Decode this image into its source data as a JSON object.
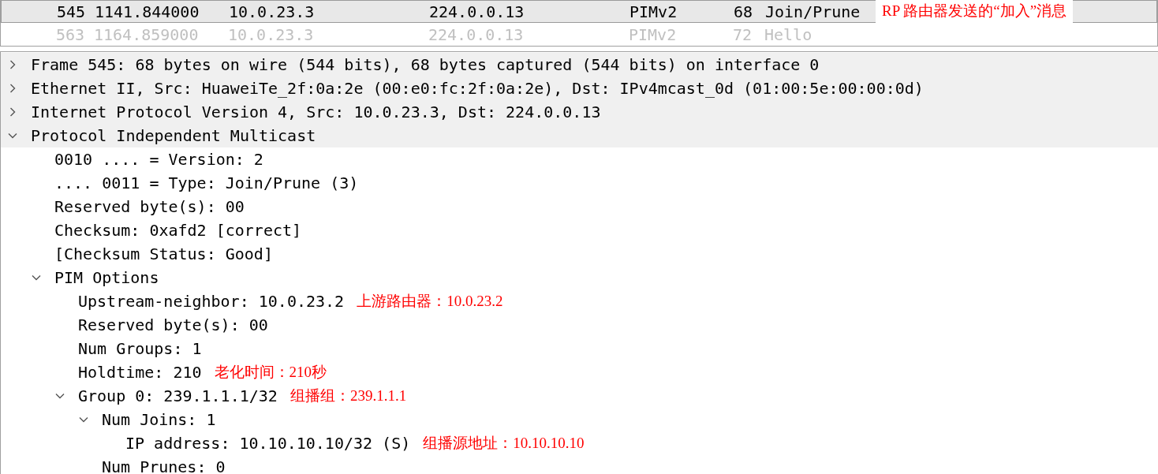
{
  "packets": [
    {
      "no": "545",
      "time": "1141.844000",
      "source": "10.0.23.3",
      "destination": "224.0.0.13",
      "protocol": "PIMv2",
      "length": "68",
      "info": "Join/Prune",
      "selected": true,
      "note": "RP 路由器发送的“加入”消息"
    },
    {
      "no": "563",
      "time": "1164.859000",
      "source": "10.0.23.3",
      "destination": "224.0.0.13",
      "protocol": "PIMv2",
      "length": "72",
      "info": "Hello",
      "selected": false
    }
  ],
  "tree": [
    {
      "label": "Frame 545: 68 bytes on wire (544 bits), 68 bytes captured (544 bits) on interface 0",
      "expanded": false
    },
    {
      "label": "Ethernet II, Src: HuaweiTe_2f:0a:2e (00:e0:fc:2f:0a:2e), Dst: IPv4mcast_0d (01:00:5e:00:00:0d)",
      "expanded": false
    },
    {
      "label": "Internet Protocol Version 4, Src: 10.0.23.3, Dst: 224.0.0.13",
      "expanded": false
    },
    {
      "label": "Protocol Independent Multicast",
      "expanded": true,
      "children": [
        {
          "label": "0010 .... = Version: 2"
        },
        {
          "label": ".... 0011 = Type: Join/Prune (3)"
        },
        {
          "label": "Reserved byte(s): 00"
        },
        {
          "label": "Checksum: 0xafd2 [correct]"
        },
        {
          "label": "[Checksum Status: Good]"
        },
        {
          "label": "PIM Options",
          "expanded": true,
          "children": [
            {
              "label": "Upstream-neighbor: 10.0.23.2",
              "note": "上游路由器：10.0.23.2"
            },
            {
              "label": "Reserved byte(s): 00"
            },
            {
              "label": "Num Groups: 1"
            },
            {
              "label": "Holdtime: 210",
              "note": "老化时间：210秒"
            },
            {
              "label": "Group 0: 239.1.1.1/32",
              "expanded": true,
              "note": "组播组：239.1.1.1",
              "children": [
                {
                  "label": "Num Joins: 1",
                  "expanded": true,
                  "children": [
                    {
                      "label": "IP address: 10.10.10.10/32 (S)",
                      "note": "组播源地址：10.10.10.10"
                    }
                  ]
                },
                {
                  "label": "Num Prunes: 0"
                }
              ]
            }
          ]
        }
      ]
    }
  ]
}
